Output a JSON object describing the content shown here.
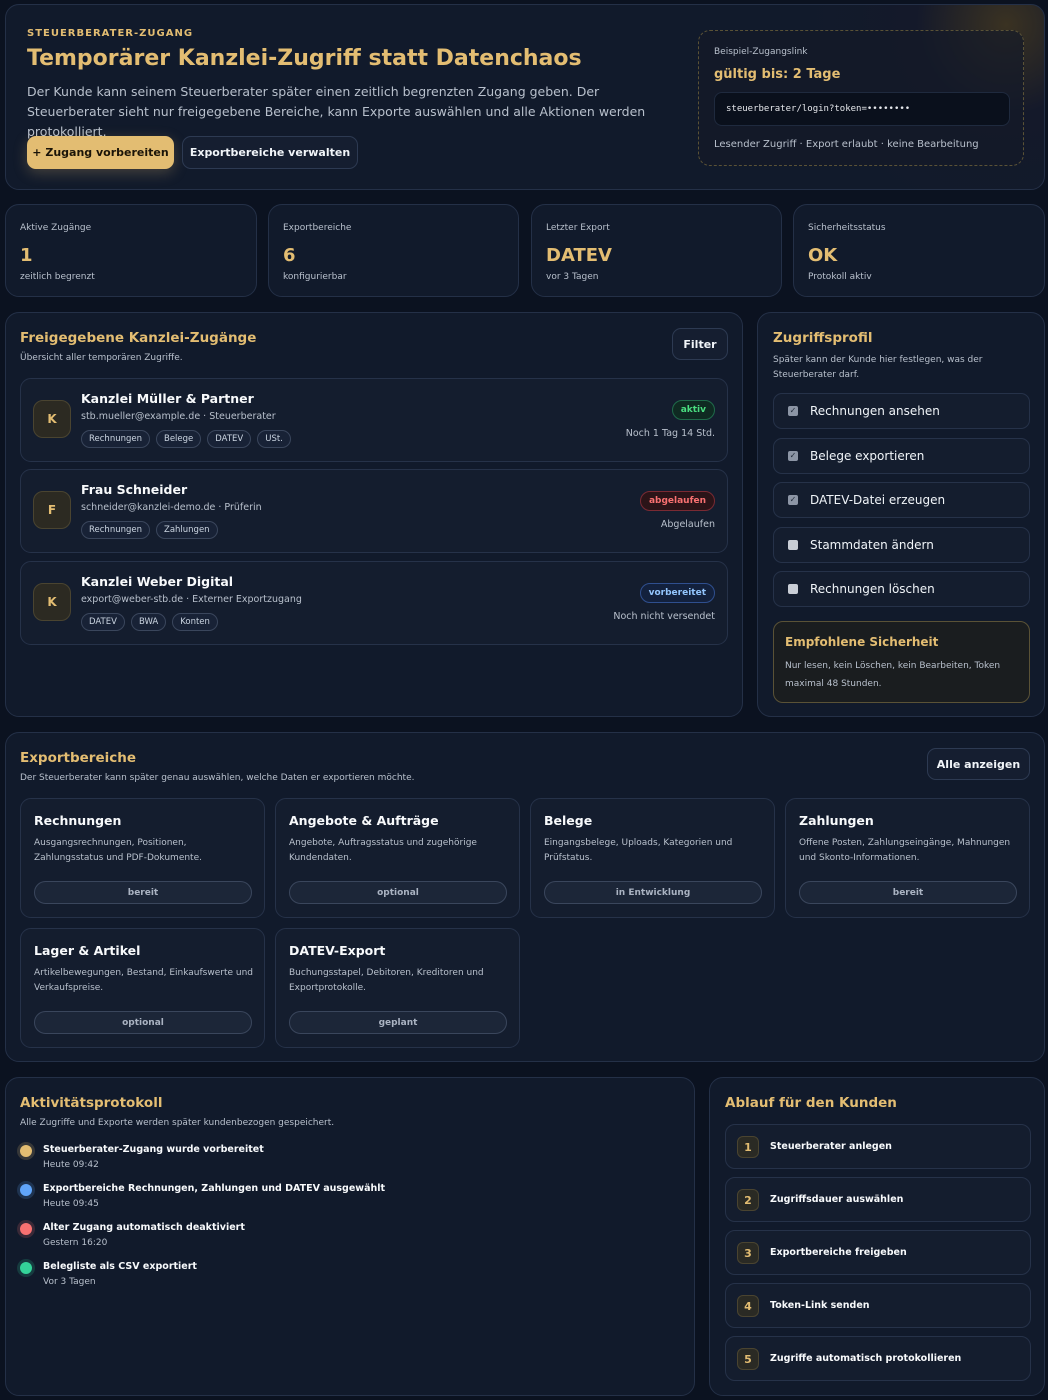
{
  "hero": {
    "eyebrow": "STEUERBERATER-ZUGANG",
    "title": "Temporärer Kanzlei-Zugriff statt Datenchaos",
    "description": "Der Kunde kann seinem Steuerberater später einen zeitlich begrenzten Zugang geben. Der Steuerberater sieht nur freigegebene Bereiche, kann Exporte auswählen und alle Aktionen werden protokolliert.",
    "primary_button": "+ Zugang vorbereiten",
    "secondary_button": "Exportbereiche verwalten",
    "example": {
      "label": "Beispiel-Zugangslink",
      "valid": "gültig bis: 2 Tage",
      "token": "steuerberater/login?token=••••••••",
      "permissions": "Lesender Zugriff · Export erlaubt · keine Bearbeitung"
    }
  },
  "stats": [
    {
      "label": "Aktive Zugänge",
      "value": "1",
      "sub": "zeitlich begrenzt"
    },
    {
      "label": "Exportbereiche",
      "value": "6",
      "sub": "konfigurierbar"
    },
    {
      "label": "Letzter Export",
      "value": "DATEV",
      "sub": "vor 3 Tagen"
    },
    {
      "label": "Sicherheitsstatus",
      "value": "OK",
      "sub": "Protokoll aktiv"
    }
  ],
  "access": {
    "title": "Freigegebene Kanzlei-Zugänge",
    "subtitle": "Übersicht aller temporären Zugriffe.",
    "filter_button": "Filter",
    "items": [
      {
        "initial": "K",
        "name": "Kanzlei Müller & Partner",
        "email": "stb.mueller@example.de · Steuerberater",
        "tags": [
          "Rechnungen",
          "Belege",
          "DATEV",
          "USt."
        ],
        "status": "aktiv",
        "time": "Noch 1 Tag 14 Std."
      },
      {
        "initial": "F",
        "name": "Frau Schneider",
        "email": "schneider@kanzlei-demo.de · Prüferin",
        "tags": [
          "Rechnungen",
          "Zahlungen"
        ],
        "status": "abgelaufen",
        "time": "Abgelaufen"
      },
      {
        "initial": "K",
        "name": "Kanzlei Weber Digital",
        "email": "export@weber-stb.de · Externer Exportzugang",
        "tags": [
          "DATEV",
          "BWA",
          "Konten"
        ],
        "status": "vorbereitet",
        "time": "Noch nicht versendet"
      }
    ]
  },
  "profile": {
    "title": "Zugriffsprofil",
    "subtitle": "Später kann der Kunde hier festlegen, was der Steuerberater darf.",
    "permissions": [
      {
        "label": "Rechnungen ansehen",
        "checked": true
      },
      {
        "label": "Belege exportieren",
        "checked": true
      },
      {
        "label": "DATEV-Datei erzeugen",
        "checked": true
      },
      {
        "label": "Stammdaten ändern",
        "checked": false
      },
      {
        "label": "Rechnungen löschen",
        "checked": false
      }
    ],
    "recommendation": {
      "title": "Empfohlene Sicherheit",
      "text": "Nur lesen, kein Löschen, kein Bearbeiten, Token maximal 48 Stunden."
    }
  },
  "exports": {
    "title": "Exportbereiche",
    "subtitle": "Der Steuerberater kann später genau auswählen, welche Daten er exportieren möchte.",
    "show_all_button": "Alle anzeigen",
    "items": [
      {
        "title": "Rechnungen",
        "desc": "Ausgangsrechnungen, Positionen, Zahlungsstatus und PDF-Dokumente.",
        "badge": "bereit"
      },
      {
        "title": "Angebote & Aufträge",
        "desc": "Angebote, Auftragsstatus und zugehörige Kundendaten.",
        "badge": "optional"
      },
      {
        "title": "Belege",
        "desc": "Eingangsbelege, Uploads, Kategorien und Prüfstatus.",
        "badge": "in Entwicklung"
      },
      {
        "title": "Zahlungen",
        "desc": "Offene Posten, Zahlungseingänge, Mahnungen und Skonto-Informationen.",
        "badge": "bereit"
      },
      {
        "title": "Lager & Artikel",
        "desc": "Artikelbewegungen, Bestand, Einkaufswerte und Verkaufspreise.",
        "badge": "optional"
      },
      {
        "title": "DATEV-Export",
        "desc": "Buchungsstapel, Debitoren, Kreditoren und Exportprotokolle.",
        "badge": "geplant"
      }
    ]
  },
  "activity": {
    "title": "Aktivitätsprotokoll",
    "subtitle": "Alle Zugriffe und Exporte werden später kundenbezogen gespeichert.",
    "items": [
      {
        "text": "Steuerberater-Zugang wurde vorbereitet",
        "time": "Heute 09:42",
        "color": "#e3bd72"
      },
      {
        "text": "Exportbereiche Rechnungen, Zahlungen und DATEV ausgewählt",
        "time": "Heute 09:45",
        "color": "#60a5fa"
      },
      {
        "text": "Alter Zugang automatisch deaktiviert",
        "time": "Gestern 16:20",
        "color": "#f87171"
      },
      {
        "text": "Belegliste als CSV exportiert",
        "time": "Vor 3 Tagen",
        "color": "#34d399"
      }
    ]
  },
  "flow": {
    "title": "Ablauf für den Kunden",
    "steps": [
      {
        "num": "1",
        "label": "Steuerberater anlegen"
      },
      {
        "num": "2",
        "label": "Zugriffsdauer auswählen"
      },
      {
        "num": "3",
        "label": "Exportbereiche freigeben"
      },
      {
        "num": "4",
        "label": "Token-Link senden"
      },
      {
        "num": "5",
        "label": "Zugriffe automatisch protokollieren"
      }
    ]
  }
}
